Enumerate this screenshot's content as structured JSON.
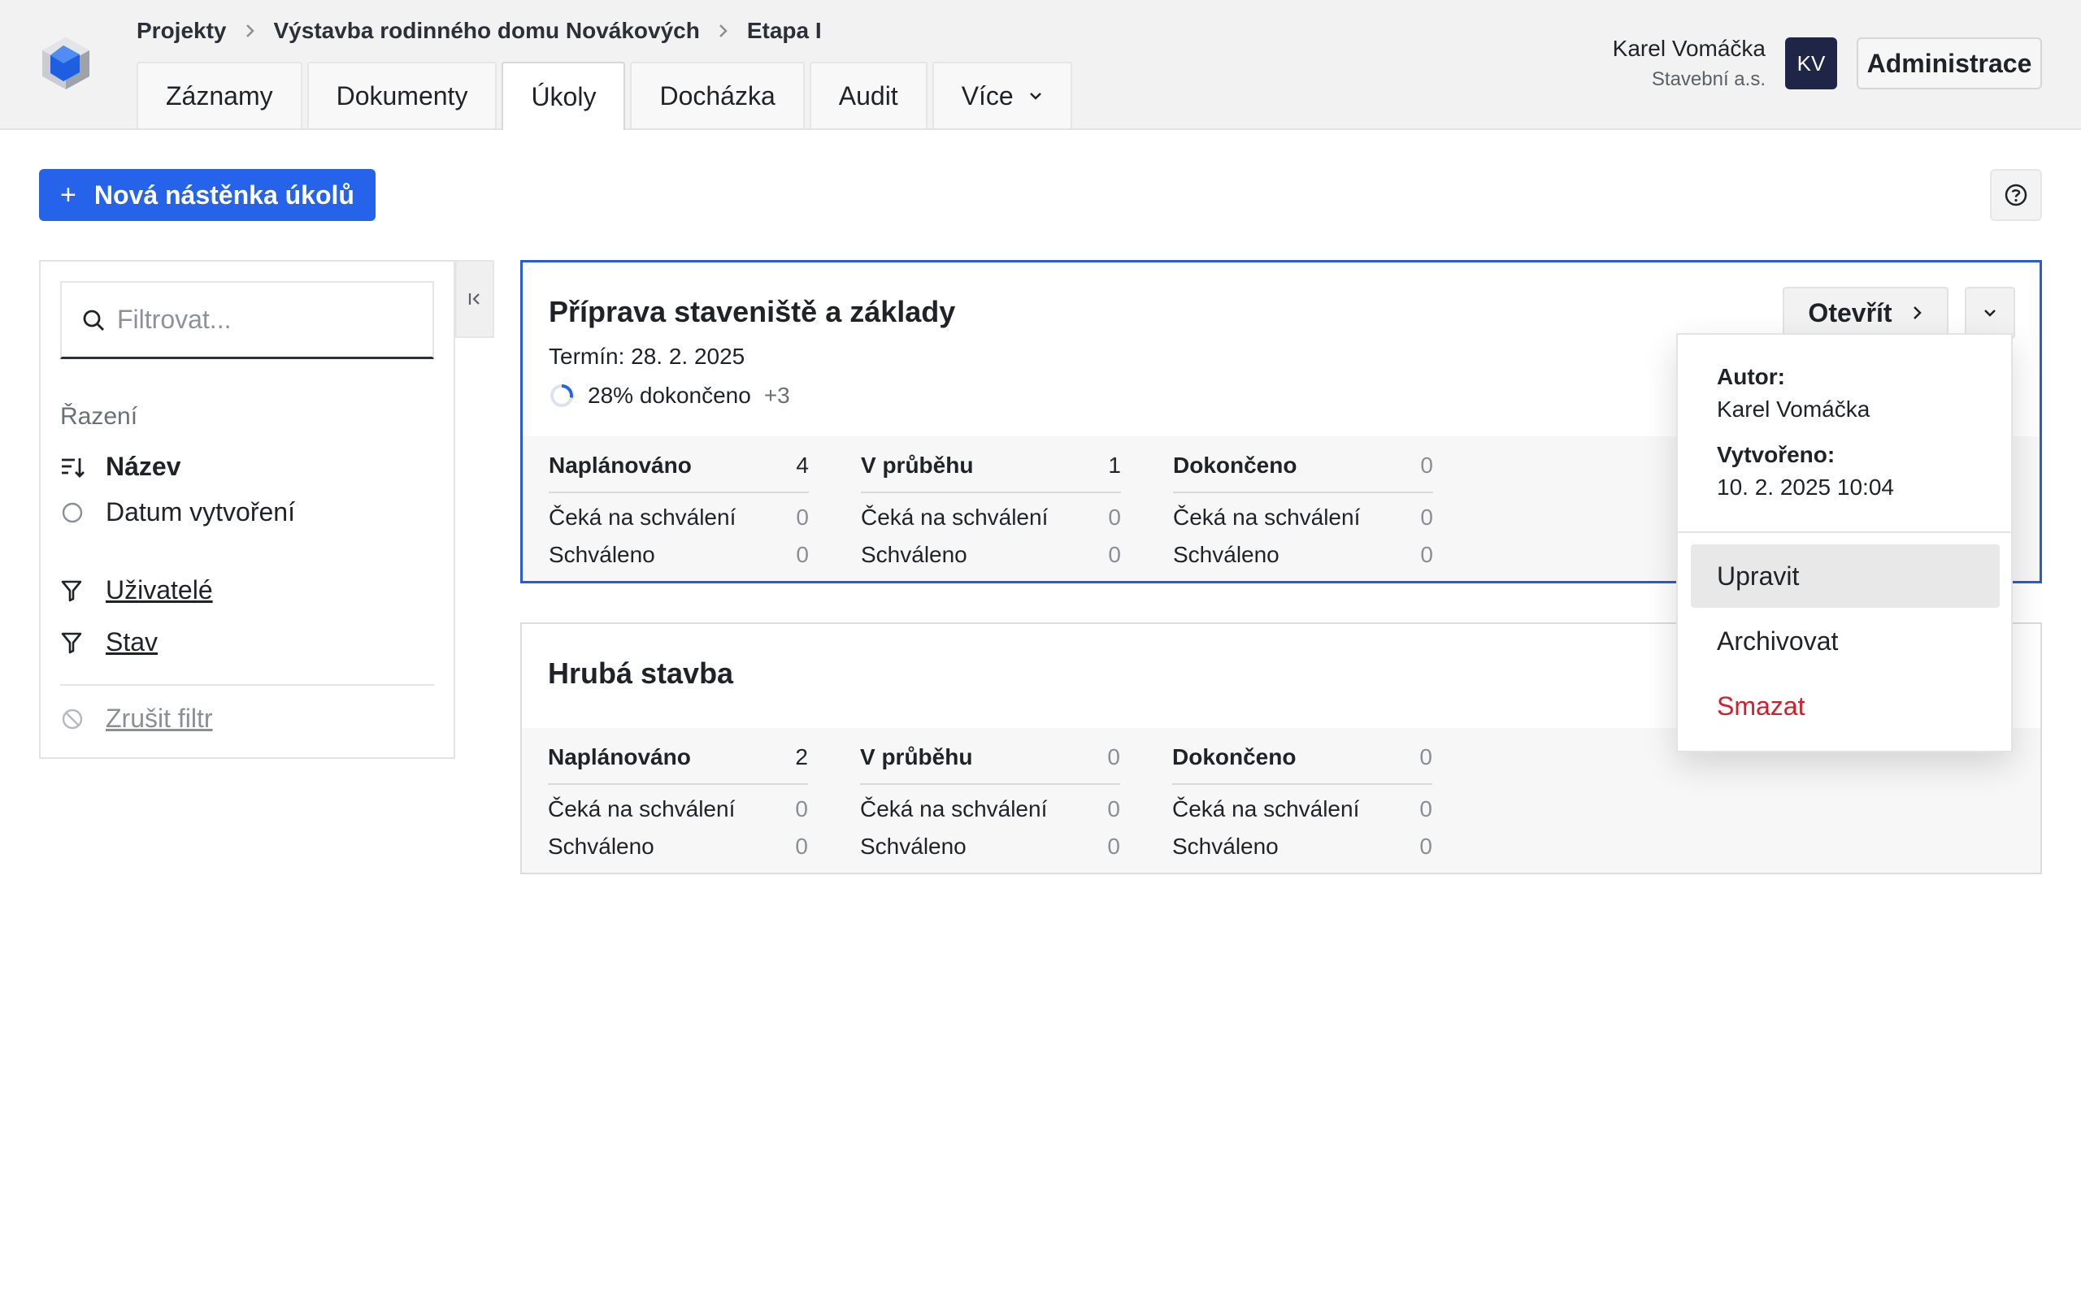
{
  "header": {
    "breadcrumb": [
      "Projekty",
      "Výstavba rodinného domu Novákových",
      "Etapa I"
    ],
    "tabs": [
      {
        "label": "Záznamy",
        "active": false
      },
      {
        "label": "Dokumenty",
        "active": false
      },
      {
        "label": "Úkoly",
        "active": true
      },
      {
        "label": "Docházka",
        "active": false
      },
      {
        "label": "Audit",
        "active": false
      },
      {
        "label": "Více",
        "active": false,
        "has_chevron": true
      }
    ],
    "user": {
      "name": "Karel Vomáčka",
      "company": "Stavební a.s.",
      "initials": "KV"
    },
    "admin_label": "Administrace"
  },
  "toolbar": {
    "new_board_label": "Nová nástěnka úkolů",
    "help_icon": "question-circle-icon"
  },
  "sidebar": {
    "filter_placeholder": "Filtrovat...",
    "sort_label": "Řazení",
    "sort_options": [
      {
        "label": "Název",
        "selected": true
      },
      {
        "label": "Datum vytvoření",
        "selected": false
      }
    ],
    "filters": [
      {
        "label": "Uživatelé"
      },
      {
        "label": "Stav"
      }
    ],
    "clear_label": "Zrušit filtr"
  },
  "boards": [
    {
      "title": "Příprava staveniště a základy",
      "deadline": "Termín: 28. 2. 2025",
      "progress_label": "28% dokončeno",
      "progress": 0.28,
      "more": "+3",
      "open_label": "Otevřít",
      "columns": [
        {
          "head": "Naplánováno",
          "count": "4",
          "rows": [
            {
              "label": "Čeká na schválení",
              "value": "0"
            },
            {
              "label": "Schváleno",
              "value": "0"
            }
          ]
        },
        {
          "head": "V průběhu",
          "count": "1",
          "rows": [
            {
              "label": "Čeká na schválení",
              "value": "0"
            },
            {
              "label": "Schváleno",
              "value": "0"
            }
          ]
        },
        {
          "head": "Dokončeno",
          "count": "0",
          "rows": [
            {
              "label": "Čeká na schválení",
              "value": "0"
            },
            {
              "label": "Schváleno",
              "value": "0"
            }
          ]
        }
      ]
    },
    {
      "title": "Hrubá stavba",
      "columns": [
        {
          "head": "Naplánováno",
          "count": "2",
          "rows": [
            {
              "label": "Čeká na schválení",
              "value": "0"
            },
            {
              "label": "Schváleno",
              "value": "0"
            }
          ]
        },
        {
          "head": "V průběhu",
          "count": "0",
          "rows": [
            {
              "label": "Čeká na schválení",
              "value": "0"
            },
            {
              "label": "Schváleno",
              "value": "0"
            }
          ]
        },
        {
          "head": "Dokončeno",
          "count": "0",
          "rows": [
            {
              "label": "Čeká na schválení",
              "value": "0"
            },
            {
              "label": "Schváleno",
              "value": "0"
            }
          ]
        }
      ]
    }
  ],
  "menu": {
    "author_label": "Autor:",
    "author": "Karel Vomáčka",
    "created_label": "Vytvořeno:",
    "created": "10. 2. 2025 10:04",
    "items": [
      "Upravit",
      "Archivovat",
      "Smazat"
    ]
  },
  "colors": {
    "accent": "#2563eb",
    "danger": "#d21f2b",
    "avatar_bg": "#1f2547",
    "selected_border": "#2a5bd7"
  }
}
